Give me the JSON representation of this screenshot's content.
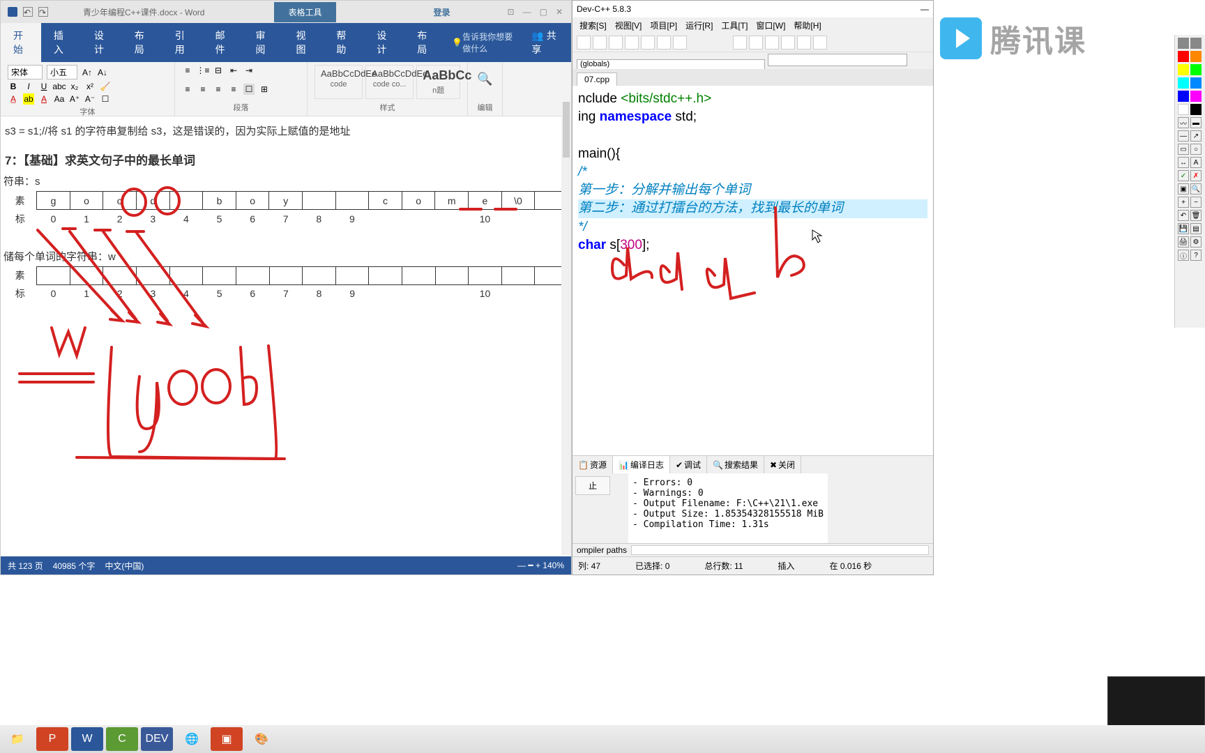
{
  "word": {
    "filename": "青少年编程C++课件.docx - Word",
    "tool_tab": "表格工具",
    "login": "登录",
    "tabs": [
      "开始",
      "插入",
      "设计",
      "布局",
      "引用",
      "邮件",
      "审阅",
      "视图",
      "帮助",
      "设计",
      "布局"
    ],
    "tell_me": "告诉我你想要做什么",
    "share": "共享",
    "font_name": "宋体",
    "font_size": "小五",
    "group_font": "字体",
    "group_para": "段落",
    "group_style": "样式",
    "group_edit": "编辑",
    "styles": [
      {
        "preview": "AaBbCcDdEe",
        "name": "code"
      },
      {
        "preview": "AaBbCcDdEe",
        "name": "code co..."
      },
      {
        "preview": "AaBbCc",
        "name": "n题"
      }
    ],
    "doc": {
      "line1": "s3 = s1;//将 s1 的字符串复制给 s3，这是错误的，因为实际上赋值的是地址",
      "heading": "7：【基础】求英文句子中的最长单词",
      "string_label": "符串：s",
      "store_label": "储每个单词的字符串：w",
      "row1": [
        "g",
        "o",
        "o",
        "d",
        "",
        "b",
        "o",
        "y",
        "",
        "",
        "c",
        "o",
        "m",
        "e",
        "\\0",
        ""
      ],
      "idx1": [
        "0",
        "1",
        "2",
        "3",
        "4",
        "5",
        "6",
        "7",
        "8",
        "9",
        "10"
      ],
      "row2": [
        "",
        "",
        "",
        "",
        "",
        "",
        "",
        "",
        "",
        "",
        "",
        "",
        "",
        "",
        "",
        ""
      ],
      "idx2": [
        "0",
        "1",
        "2",
        "3",
        "4",
        "5",
        "6",
        "7",
        "8",
        "9",
        "10"
      ],
      "cell_label_left": "素",
      "index_label_left": "标"
    },
    "status": {
      "pages": "共 123 页",
      "words": "40985 个字",
      "lang": "中文(中国)",
      "zoom": "140%"
    }
  },
  "devcpp": {
    "title": "Dev-C++ 5.8.3",
    "menus": [
      "搜索[S]",
      "视图[V]",
      "项目[P]",
      "运行[R]",
      "工具[T]",
      "窗口[W]",
      "帮助[H]"
    ],
    "globals": "(globals)",
    "file_tab": "07.cpp",
    "code": {
      "l1a": "nclude ",
      "l1b": "<bits/stdc++.h>",
      "l2a": "ing ",
      "l2b": "namespace",
      "l2c": " std;",
      "l3a": "  main(){",
      "l4": "  /*",
      "l5": "    第一步：分解并输出每个单词",
      "l6": "    第二步：通过打擂台的方法，找到最长的单词",
      "l7": "  */",
      "l8a": "  ",
      "l8b": "char",
      "l8c": " s[",
      "l8d": "300",
      "l8e": "];"
    },
    "btabs": [
      "资源",
      "编译日志",
      "调试",
      "搜索结果",
      "关闭"
    ],
    "stop": "止",
    "output": "- Errors: 0\n- Warnings: 0\n- Output Filename: F:\\C++\\21\\1.exe\n- Output Size: 1.85354328155518 MiB\n- Compilation Time: 1.31s",
    "paths_label": "ompiler paths",
    "status": {
      "col": "列:   47",
      "sel": "已选择:   0",
      "total": "总行数:   11",
      "mode": "插入",
      "time": "在 0.016 秒"
    }
  },
  "watermark": "腾讯课",
  "annot_colors": [
    "#ff0000",
    "#ff8000",
    "#ffff00",
    "#00ff00",
    "#00ffff",
    "#0080ff",
    "#0000ff",
    "#ff00ff",
    "#ffffff",
    "#000000"
  ]
}
